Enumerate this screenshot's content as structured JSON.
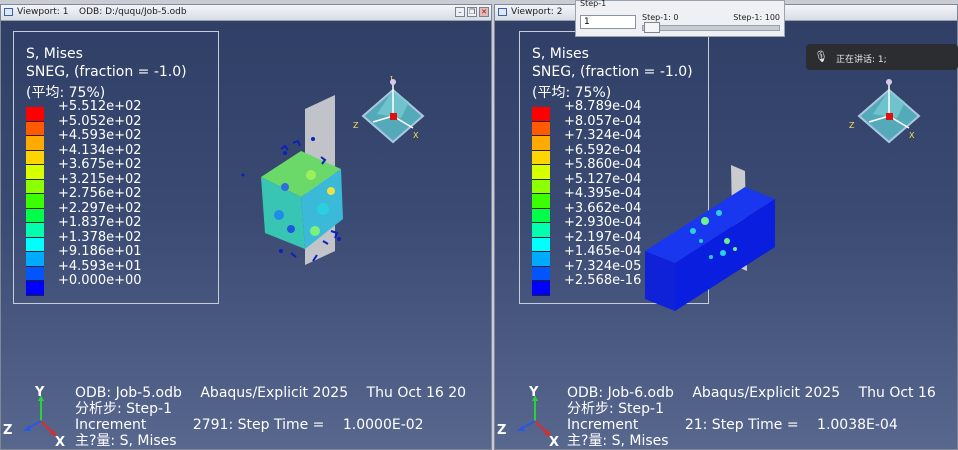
{
  "viewport1": {
    "name": "Viewport: 1",
    "odb_path": "ODB: D:/ququ/Job-5.odb",
    "legend": {
      "line1": "S, Mises",
      "line2": "SNEG, (fraction = -1.0)",
      "line3": "(平均: 75%)",
      "ticks": [
        "+5.512e+02",
        "+5.052e+02",
        "+4.593e+02",
        "+4.134e+02",
        "+3.675e+02",
        "+3.215e+02",
        "+2.756e+02",
        "+2.297e+02",
        "+1.837e+02",
        "+1.378e+02",
        "+9.186e+01",
        "+4.593e+01",
        "+0.000e+00"
      ]
    },
    "info": {
      "odb": "ODB: Job-5.odb",
      "solver": "Abaqus/Explicit 2025",
      "date": "Thu Oct 16 20",
      "step": "分析步: Step-1",
      "increment_label": "Increment",
      "increment": "2791: Step Time =",
      "step_time": "1.0000E-02",
      "variable": "主?量: S, Mises"
    }
  },
  "viewport2": {
    "name": "Viewport: 2",
    "legend": {
      "line1": "S, Mises",
      "line2": "SNEG, (fraction = -1.0)",
      "line3": "(平均: 75%)",
      "ticks": [
        "+8.789e-04",
        "+8.057e-04",
        "+7.324e-04",
        "+6.592e-04",
        "+5.860e-04",
        "+5.127e-04",
        "+4.395e-04",
        "+3.662e-04",
        "+2.930e-04",
        "+2.197e-04",
        "+1.465e-04",
        "+7.324e-05",
        "+2.568e-16"
      ]
    },
    "info": {
      "odb": "ODB: Job-6.odb",
      "solver": "Abaqus/Explicit 2025",
      "date": "Thu Oct 16",
      "step": "分析步: Step-1",
      "increment_label": "Increment",
      "increment": "21: Step Time =",
      "step_time": "1.0038E-04",
      "variable": "主?量: S, Mises"
    }
  },
  "triad": {
    "x": "X",
    "y": "Y",
    "z": "Z"
  },
  "view_cube": {
    "x": "X",
    "y": "Y",
    "z": "Z"
  },
  "step_window": {
    "title": "Step-1",
    "frame_value": "1",
    "left_label": "Step-1: 0",
    "right_label": "Step-1: 100"
  },
  "speech_popup": {
    "text": "正在讲话:  1;"
  },
  "colors": [
    "#ff0000",
    "#ff5a00",
    "#ffaa00",
    "#ffd400",
    "#d6ff00",
    "#8cff00",
    "#3bff00",
    "#00ff48",
    "#00ffae",
    "#00ffff",
    "#00aaff",
    "#0055ff",
    "#0000ff"
  ]
}
